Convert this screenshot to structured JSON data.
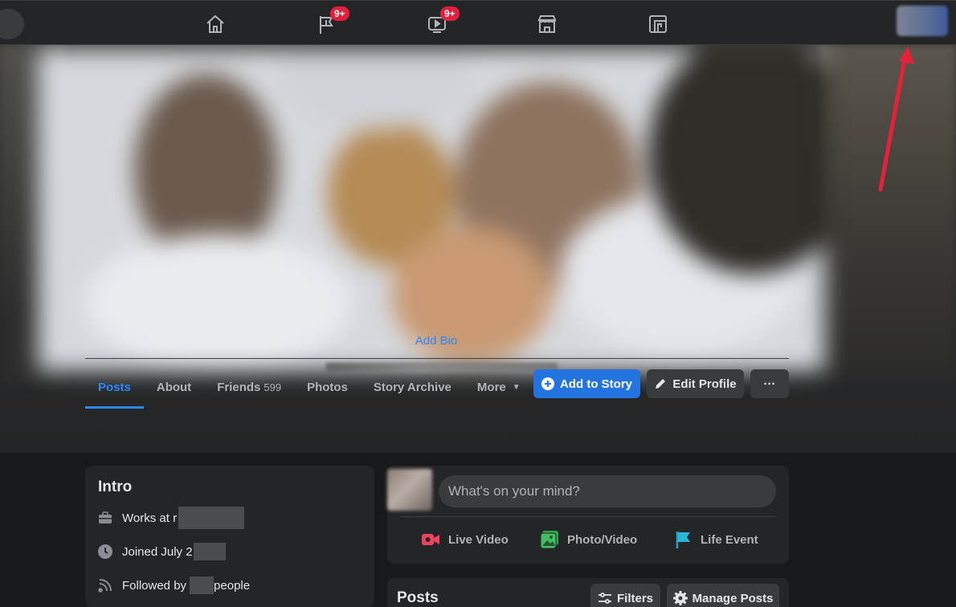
{
  "topnav": {
    "icons": [
      {
        "name": "home-icon"
      },
      {
        "name": "pages-flag-icon",
        "badge": "9+"
      },
      {
        "name": "watch-icon",
        "badge": "9+"
      },
      {
        "name": "marketplace-icon"
      },
      {
        "name": "gaming-icon"
      }
    ]
  },
  "profile": {
    "add_bio": "Add Bio"
  },
  "tabs": [
    {
      "label": "Posts",
      "active": true
    },
    {
      "label": "About"
    },
    {
      "label": "Friends",
      "count": "599"
    },
    {
      "label": "Photos"
    },
    {
      "label": "Story Archive"
    },
    {
      "label": "More"
    }
  ],
  "actions": {
    "add_story": "Add to Story",
    "edit_profile": "Edit Profile",
    "more": "···"
  },
  "intro": {
    "title": "Intro",
    "works_at": "Works at r",
    "joined": "Joined July 2",
    "followed_by": "Followed by",
    "followed_suffix": "people"
  },
  "composer": {
    "placeholder": "What's on your mind?",
    "live_video": "Live Video",
    "photo_video": "Photo/Video",
    "life_event": "Life Event"
  },
  "posts": {
    "title": "Posts",
    "filters": "Filters",
    "manage": "Manage Posts"
  },
  "colors": {
    "accent": "#2d88ff",
    "badge": "#e41e3f",
    "annotation_arrow": "#e8203a"
  }
}
